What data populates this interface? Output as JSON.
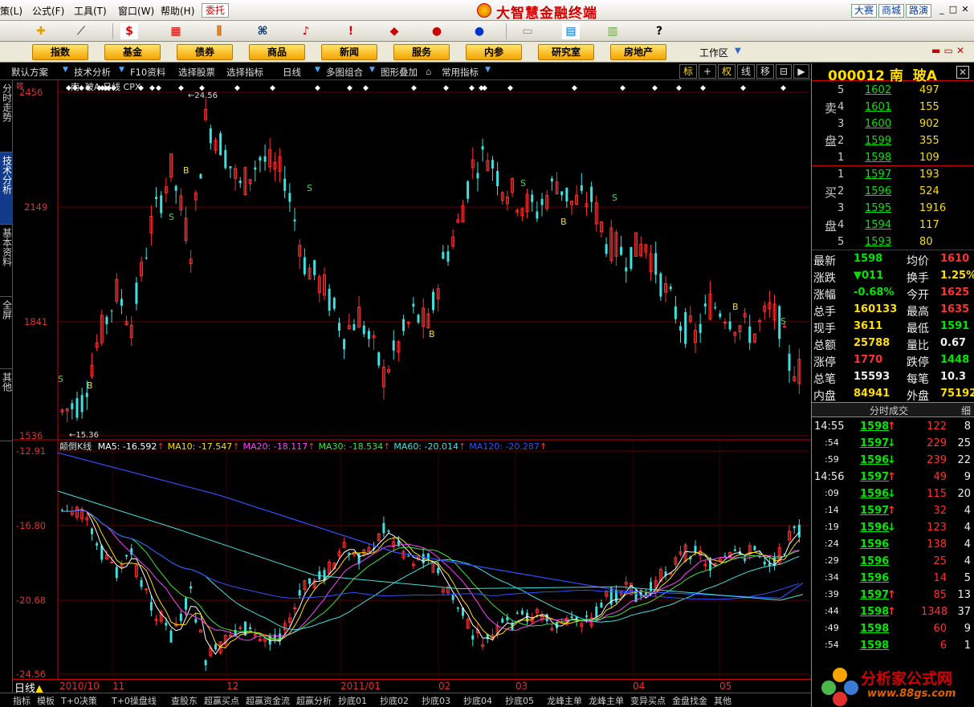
{
  "app": {
    "title": "大智慧金融终端",
    "weituo": "委托",
    "menus": [
      "策(L)",
      "公式(F)",
      "工具(T)",
      "窗口(W)",
      "帮助(H)"
    ],
    "top_buttons": [
      "大赛",
      "商城",
      "路演"
    ]
  },
  "categories": [
    "指数",
    "基金",
    "债券",
    "商品",
    "新闻",
    "服务",
    "内参",
    "研究室",
    "房地产"
  ],
  "workarea": "工作区",
  "subbar": {
    "items": [
      "默认方案",
      "技术分析",
      "F10资料",
      "选择股票",
      "选择指标",
      "日线",
      "多图组合",
      "图形叠加",
      "常用指标"
    ],
    "right_buttons": [
      "标",
      "+",
      "权",
      "线",
      "移",
      "",
      ""
    ]
  },
  "left_tabs": [
    "分时走势",
    "技术分析",
    "基本资料",
    "全屏",
    "其他"
  ],
  "chart": {
    "header": "南  玻A 日线 CPX",
    "high_label": "24.56",
    "low_label": "15.36",
    "y_main_labels": [
      "2456",
      "2149",
      "1841",
      "1536"
    ],
    "y_sub_labels": [
      "-12.91",
      "-16.80",
      "-20.68",
      "-24.56"
    ],
    "indicator_name": "颠倒K线",
    "ma": [
      {
        "label": "MA5: -16.592",
        "color": "#ffffff"
      },
      {
        "label": "MA10: -17.547",
        "color": "#ffde00"
      },
      {
        "label": "MA20: -18.117",
        "color": "#ff40ff"
      },
      {
        "label": "MA30: -18.534",
        "color": "#40e040"
      },
      {
        "label": "MA60: -20.014",
        "color": "#40e0e0"
      },
      {
        "label": "MA120: -20.287",
        "color": "#3050ff"
      }
    ],
    "signal_B": "B",
    "signal_S": "S",
    "period": "日线",
    "date_labels": [
      "2010/10",
      "11",
      "12",
      "2011/01",
      "02",
      "03",
      "04",
      "05"
    ]
  },
  "bottom_tabs": [
    "指标",
    "模板",
    "T+0决策",
    "T+0操盘线",
    "查股东",
    "超赢买点",
    "超赢资金流",
    "超赢分析",
    "抄底01",
    "抄底02",
    "抄底03",
    "抄底04",
    "抄底05",
    "龙峰主单",
    "龙峰主单",
    "变异买点",
    "金盘找金",
    "其他"
  ],
  "quote": {
    "code": "000012",
    "name": "南  玻A",
    "sell_label": [
      "卖",
      "盘"
    ],
    "buy_label": [
      "买",
      "盘"
    ],
    "sell": [
      {
        "lvl": "5",
        "price": "1602",
        "vol": "497"
      },
      {
        "lvl": "4",
        "price": "1601",
        "vol": "155"
      },
      {
        "lvl": "3",
        "price": "1600",
        "vol": "902"
      },
      {
        "lvl": "2",
        "price": "1599",
        "vol": "355"
      },
      {
        "lvl": "1",
        "price": "1598",
        "vol": "109"
      }
    ],
    "buy": [
      {
        "lvl": "1",
        "price": "1597",
        "vol": "193"
      },
      {
        "lvl": "2",
        "price": "1596",
        "vol": "524"
      },
      {
        "lvl": "3",
        "price": "1595",
        "vol": "1916"
      },
      {
        "lvl": "4",
        "price": "1594",
        "vol": "117"
      },
      {
        "lvl": "5",
        "price": "1593",
        "vol": "80"
      }
    ],
    "stats": [
      {
        "k1": "最新",
        "v1": "1598",
        "c1": "grn",
        "k2": "均价",
        "v2": "1610",
        "c2": "red"
      },
      {
        "k1": "涨跌",
        "v1": "▼011",
        "c1": "grn",
        "k2": "换手",
        "v2": "1.25%",
        "c2": "yel"
      },
      {
        "k1": "涨幅",
        "v1": "-0.68%",
        "c1": "grn",
        "k2": "今开",
        "v2": "1625",
        "c2": "red"
      },
      {
        "k1": "总手",
        "v1": "160133",
        "c1": "yel",
        "k2": "最高",
        "v2": "1635",
        "c2": "red"
      },
      {
        "k1": "现手",
        "v1": "3611",
        "c1": "yel",
        "k2": "最低",
        "v2": "1591",
        "c2": "grn"
      },
      {
        "k1": "总额",
        "v1": "25788",
        "c1": "yel",
        "k2": "量比",
        "v2": "0.67",
        "c2": "wht"
      },
      {
        "k1": "涨停",
        "v1": "1770",
        "c1": "red",
        "k2": "跌停",
        "v2": "1448",
        "c2": "grn"
      },
      {
        "k1": "总笔",
        "v1": "15593",
        "c1": "wht",
        "k2": "每笔",
        "v2": "10.3",
        "c2": "wht"
      },
      {
        "k1": "内盘",
        "v1": "84941",
        "c1": "yel",
        "k2": "外盘",
        "v2": "75192",
        "c2": "yel"
      }
    ],
    "tick_header": "分时成交",
    "tick_detail": "细",
    "ticks": [
      {
        "t": "14:55",
        "p": "1598",
        "a": "↑",
        "v": "122",
        "n": "8"
      },
      {
        "t": ":54",
        "p": "1597",
        "a": "↓",
        "v": "229",
        "n": "25"
      },
      {
        "t": ":59",
        "p": "1596",
        "a": "↓",
        "v": "239",
        "n": "22"
      },
      {
        "t": "14:56",
        "p": "1597",
        "a": "↑",
        "v": "49",
        "n": "9"
      },
      {
        "t": ":09",
        "p": "1596",
        "a": "↓",
        "v": "115",
        "n": "20"
      },
      {
        "t": ":14",
        "p": "1597",
        "a": "↑",
        "v": "32",
        "n": "4"
      },
      {
        "t": ":19",
        "p": "1596",
        "a": "↓",
        "v": "123",
        "n": "4"
      },
      {
        "t": ":24",
        "p": "1596",
        "a": "",
        "v": "138",
        "n": "4"
      },
      {
        "t": ":29",
        "p": "1596",
        "a": "",
        "v": "25",
        "n": "4"
      },
      {
        "t": ":34",
        "p": "1596",
        "a": "",
        "v": "14",
        "n": "5"
      },
      {
        "t": ":39",
        "p": "1597",
        "a": "↑",
        "v": "85",
        "n": "13"
      },
      {
        "t": ":44",
        "p": "1598",
        "a": "↑",
        "v": "1348",
        "n": "37"
      },
      {
        "t": ":49",
        "p": "1598",
        "a": "",
        "v": "60",
        "n": "9"
      },
      {
        "t": ":54",
        "p": "1598",
        "a": "",
        "v": "6",
        "n": "1"
      }
    ]
  },
  "watermark": {
    "line1": "分析家公式网",
    "line2": "www.88gs.com"
  }
}
